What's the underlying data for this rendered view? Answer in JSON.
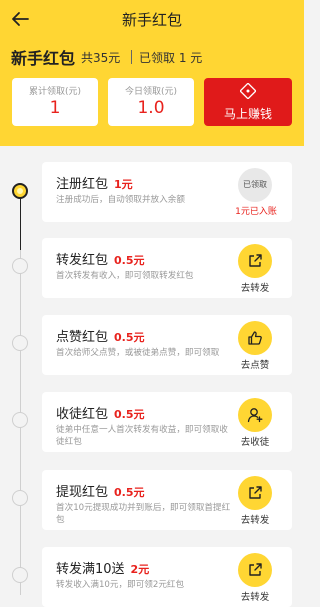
{
  "header": {
    "title": "新手红包",
    "back_icon": "arrow-left-icon"
  },
  "summary": {
    "title": "新手红包",
    "total": "共35元",
    "received": "已领取 1 元",
    "cumulative_label": "累计领取(元)",
    "cumulative_value": "1",
    "today_label": "今日领取(元)",
    "today_value": "1.0",
    "earn_label": "马上赚钱",
    "earn_icon": "diamond-icon"
  },
  "colors": {
    "accent": "#ffd633",
    "red": "#e01a1a",
    "amount": "#e8221d"
  },
  "tasks": [
    {
      "title": "注册红包",
      "amount": "1元",
      "desc": "注册成功后，自动领取并放入余额",
      "status": "已领取",
      "action_label": "1元已入账",
      "done": true
    },
    {
      "title": "转发红包",
      "amount": "0.5元",
      "desc": "首次转发有收入，即可领取转发红包",
      "action_label": "去转发",
      "icon": "share-icon"
    },
    {
      "title": "点赞红包",
      "amount": "0.5元",
      "desc": "首次给师父点赞，或被徒弟点赞，即可领取",
      "action_label": "去点赞",
      "icon": "thumbs-up-icon"
    },
    {
      "title": "收徒红包",
      "amount": "0.5元",
      "desc": "徒弟中任意一人首次转发有收益，即可领取收徒红包",
      "action_label": "去收徒",
      "icon": "add-user-icon"
    },
    {
      "title": "提现红包",
      "amount": "0.5元",
      "desc": "首次10元提现成功并到账后，即可领取首提红包",
      "action_label": "去转发",
      "icon": "share-icon"
    },
    {
      "title": "转发满10送",
      "amount": "2元",
      "desc": "转发收入满10元，即可领2元红包",
      "action_label": "去转发",
      "icon": "share-icon"
    }
  ]
}
